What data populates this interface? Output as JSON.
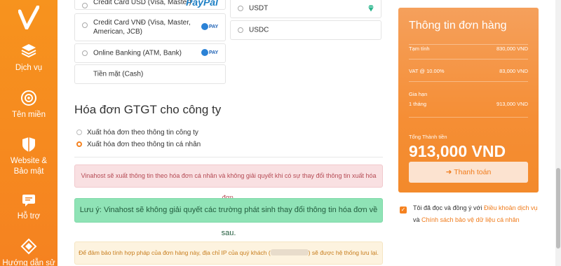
{
  "sidebar": {
    "items": [
      {
        "label": "Dịch vụ",
        "icon": "stack-icon"
      },
      {
        "label": "Tên miền",
        "icon": "globe-icon"
      },
      {
        "label": "Website &\nBảo mật",
        "icon": "shield-icon"
      },
      {
        "label": "Hỗ trợ",
        "icon": "support-icon"
      },
      {
        "label": "Hướng dẫn sử",
        "icon": "guide-icon"
      }
    ]
  },
  "payment": {
    "credit_usd": "Credit Card USD (Visa, Master)",
    "paypal": "PayPal",
    "credit_vnd": "Credit Card VNĐ (Visa, Master, American, JCB)",
    "online_banking": "Online Banking (ATM, Bank)",
    "cash": "Tiền mặt (Cash)",
    "usdt": "USDT",
    "usdc": "USDC",
    "onepay": "PAY"
  },
  "invoice": {
    "title": "Hóa đơn GTGT cho công ty",
    "option_company": "Xuất hóa đơn theo thông tin công ty",
    "option_personal": "Xuất hóa đơn theo thông tin cá nhân",
    "selected": "personal"
  },
  "alerts": {
    "red": "Vinahost sẽ xuất thông tin theo hóa đơn cá nhân và không giải quyết khi có sự thay đổi thông tin xuất hóa đơn.",
    "green": "Lưu ý: Vinahost sẽ không giải quyết các trường phát sinh thay đổi thông tin hóa đơn về sau.",
    "yellow_before": "Để đảm bảo tính hợp pháp của đơn hàng này, địa chỉ IP của quý khách (",
    "yellow_after": ") sẽ được hệ thống lưu lại."
  },
  "order": {
    "title": "Thông tin đơn hàng",
    "subtotal_label": "Tạm tính",
    "subtotal_value": "830,000 VND",
    "vat_label": "VAT @ 10.00%",
    "vat_value": "83,000 VND",
    "renewal_label": "Gia hạn",
    "term_label": "1 tháng",
    "term_value": "913,000 VND",
    "total_label": "Tổng Thành tiền",
    "total_value": "913,000 VND",
    "pay_button": "➜ Thanh toán"
  },
  "agreement": {
    "text1": "Tôi đã đọc và đồng ý với ",
    "link1": "Điều khoản dịch vụ",
    "text2": " và ",
    "link2": "Chính sách bảo vệ dữ liệu cá nhân",
    "checked": true
  },
  "colors": {
    "accent": "#f58220",
    "green_alert": "#8fe3b6",
    "red_alert": "#f9e0e2"
  }
}
